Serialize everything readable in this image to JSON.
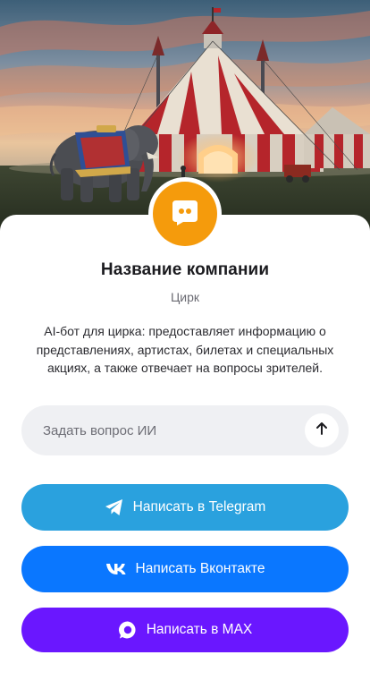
{
  "hero": {
    "image_alt": "circus tent with elephant at dusk"
  },
  "profile": {
    "company_name": "Название компании",
    "category": "Цирк",
    "description": "AI-бот для цирка: предоставляет информацию о представлениях, артистах, билетах и специальных акциях, а также отвечает на вопросы зрителей.",
    "avatar_icon": "chat-bubble-icon",
    "avatar_color": "#F59B0C"
  },
  "ask": {
    "placeholder": "Задать вопрос ИИ",
    "value": "",
    "send_icon": "arrow-up-icon"
  },
  "actions": [
    {
      "label": "Написать в Telegram",
      "icon": "telegram-icon",
      "color": "#2AA1DE"
    },
    {
      "label": "Написать Вконтакте",
      "icon": "vk-icon",
      "color": "#0A77FF"
    },
    {
      "label": "Написать в MAX",
      "icon": "max-icon",
      "color": "#6A17FF"
    }
  ]
}
